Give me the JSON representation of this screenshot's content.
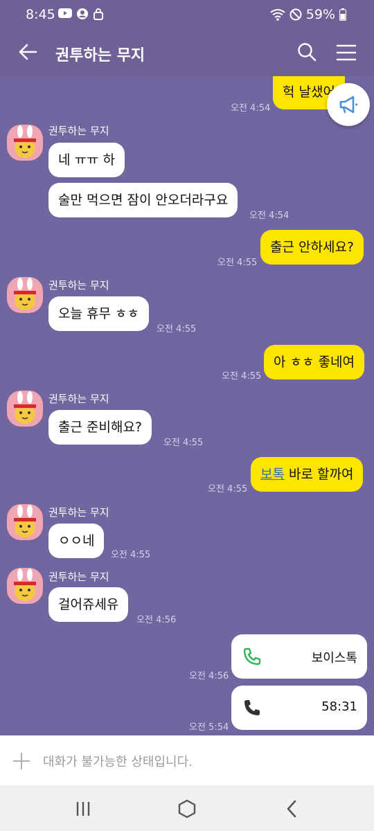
{
  "status_bar": {
    "time": "8:45",
    "battery": "59%",
    "icons_left": [
      "youtube-icon",
      "account-icon",
      "lock-icon"
    ],
    "icons_right": [
      "wifi-icon",
      "do-not-disturb-icon",
      "battery-icon"
    ]
  },
  "header": {
    "title": "권투하는 무지"
  },
  "messages": [
    {
      "side": "me",
      "text": "헉 날샜어",
      "time": "오전 4:54"
    },
    {
      "side": "them",
      "sender": "권투하는 무지",
      "text": "네 ㅠㅠ 하"
    },
    {
      "side": "them",
      "text": "술만 먹으면 잠이 안오더라구요",
      "time": "오전 4:54"
    },
    {
      "side": "me",
      "text": "출근 안하세요?",
      "time": "오전 4:55"
    },
    {
      "side": "them",
      "sender": "권투하는 무지",
      "text": "오늘 휴무 ㅎㅎ",
      "time": "오전 4:55"
    },
    {
      "side": "me",
      "text": "아 ㅎㅎ 좋네여",
      "time": "오전 4:55"
    },
    {
      "side": "them",
      "sender": "권투하는 무지",
      "text": "출근 준비해요?",
      "time": "오전 4:55"
    },
    {
      "side": "me",
      "link": "보톡",
      "text": " 바로 할까여",
      "time": "오전 4:55"
    },
    {
      "side": "them",
      "sender": "권투하는 무지",
      "text": "ㅇㅇ네",
      "time": "오전 4:55"
    },
    {
      "side": "them",
      "sender": "권투하는 무지",
      "text": "걸어쥬세유",
      "time": "오전 4:56"
    },
    {
      "side": "me",
      "type": "call",
      "text": "보이스톡",
      "time": "오전 4:56"
    },
    {
      "side": "me",
      "type": "call",
      "text": "58:31",
      "time": "오전 5:54"
    }
  ],
  "input": {
    "placeholder": "대화가 불가능한 상태입니다."
  },
  "colors": {
    "chat_bg": "#7266a0",
    "header_bg": "#6e6195",
    "my_bubble": "#fee500",
    "their_bubble": "#ffffff",
    "call_green": "#2fb457"
  }
}
